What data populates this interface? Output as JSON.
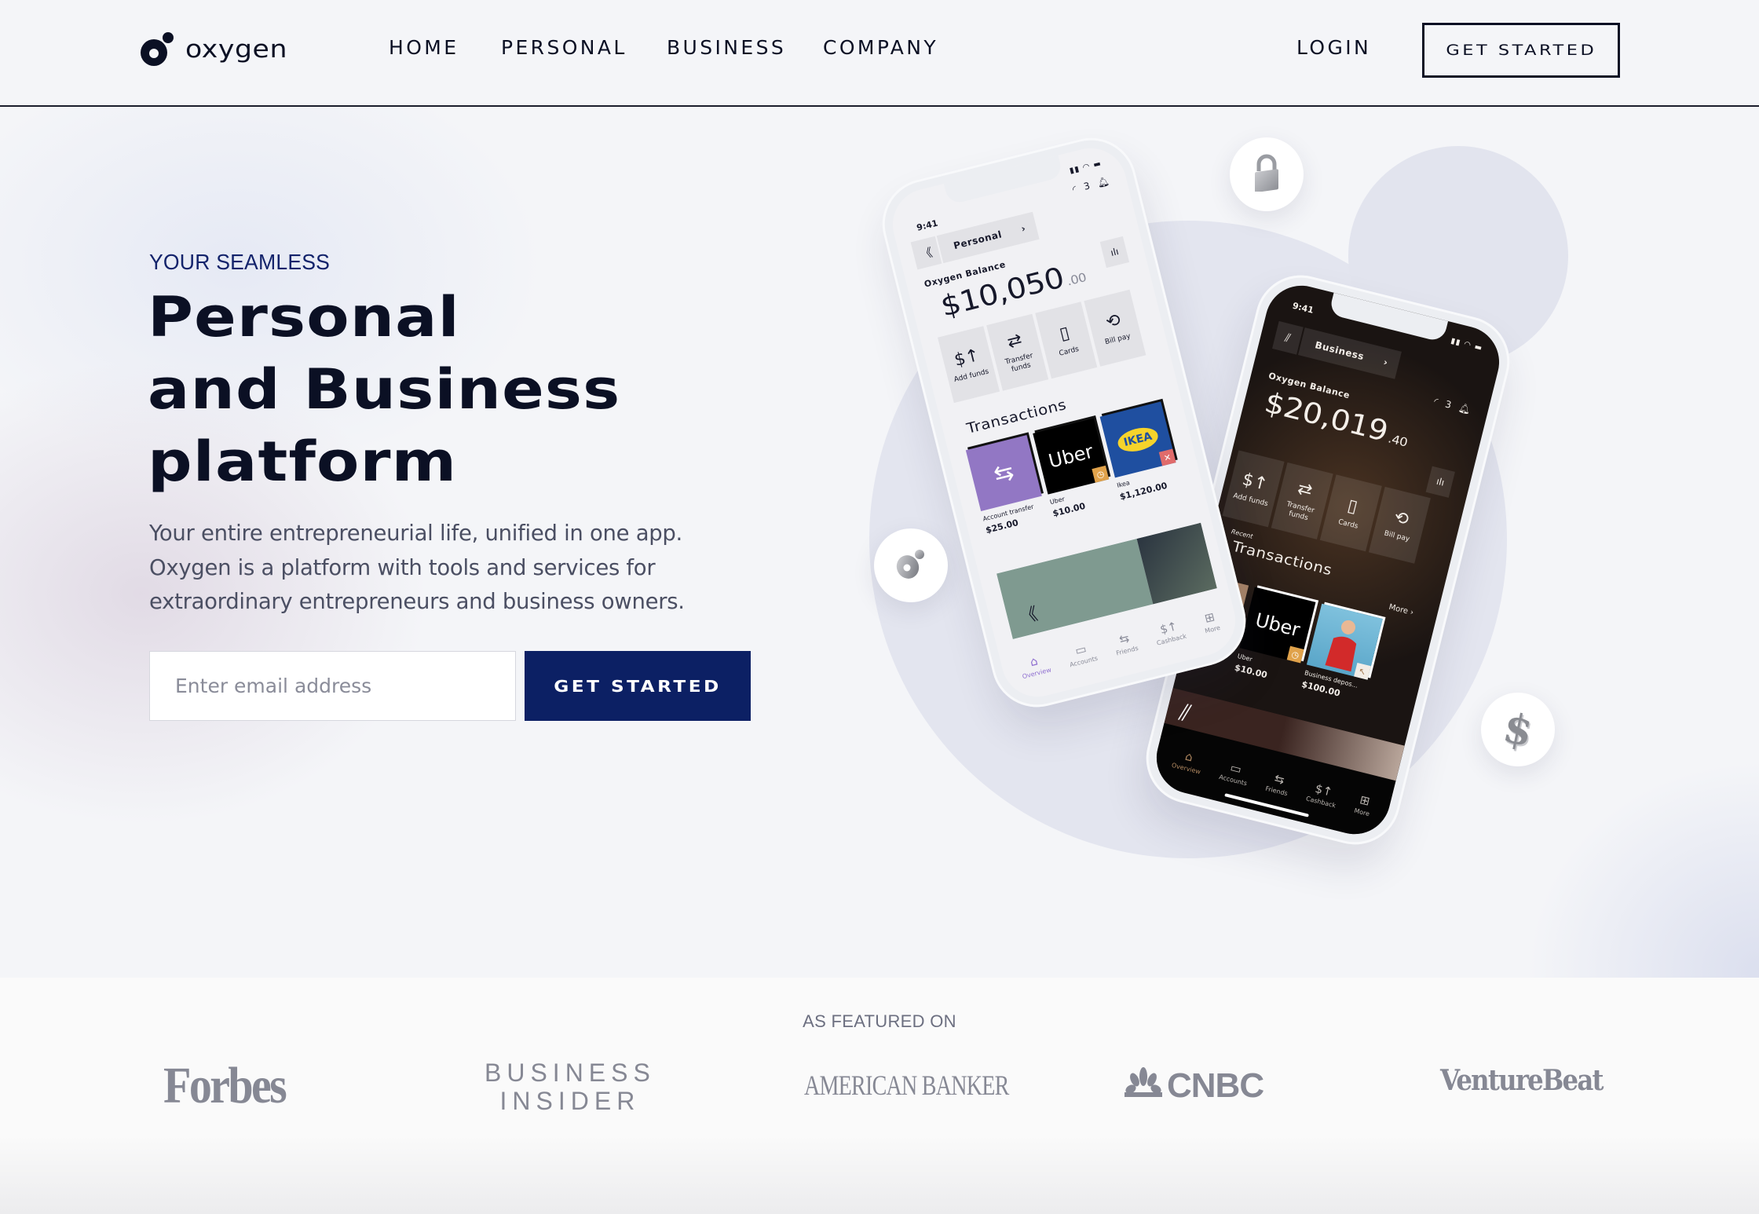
{
  "header": {
    "brand": "oxygen",
    "nav": [
      {
        "label": "HOME"
      },
      {
        "label": "PERSONAL"
      },
      {
        "label": "BUSINESS"
      },
      {
        "label": "COMPANY"
      }
    ],
    "login_label": "LOGIN",
    "cta_label": "GET STARTED"
  },
  "hero": {
    "eyebrow": "YOUR SEAMLESS",
    "headline_lines": [
      "Personal",
      "and Business",
      "platform"
    ],
    "lead": "Your entire entrepreneurial life, unified in one app. Oxygen is a platform with tools and services for extraordinary entrepreneurs and business owners.",
    "email_placeholder": "Enter email address",
    "email_value": "",
    "cta_label": "GET STARTED",
    "colors": {
      "accent": "#0c2064",
      "eyebrow": "#13236b",
      "text": "#0b1024",
      "muted": "#4b4f63"
    }
  },
  "badges": [
    {
      "icon": "lock-icon"
    },
    {
      "icon": "oxygen-logo-icon"
    },
    {
      "icon": "dollar-icon"
    }
  ],
  "phone_personal": {
    "time": "9:41",
    "account": "Personal",
    "notifications": "3",
    "balance_label": "Oxygen Balance",
    "balance_main": "$10,050",
    "balance_cents": ".00",
    "actions": [
      {
        "label": "Add funds",
        "icon": "add-funds-icon"
      },
      {
        "label": "Transfer funds",
        "icon": "transfer-icon"
      },
      {
        "label": "Cards",
        "icon": "cards-icon"
      },
      {
        "label": "Bill pay",
        "icon": "bill-pay-icon"
      }
    ],
    "transactions_title": "Transactions",
    "transactions": [
      {
        "name": "Account transfer",
        "amount": "$25.00",
        "thumb_text": "⇆",
        "thumb_color": "#9277c4"
      },
      {
        "name": "Uber",
        "amount": "$10.00",
        "thumb_text": "Uber",
        "thumb_color": "#000000"
      },
      {
        "name": "Ikea",
        "amount": "$1,120.00",
        "thumb_text": "IKEA",
        "thumb_color": "#1f4fa0"
      }
    ],
    "tabs": [
      {
        "label": "Overview",
        "icon": "home-icon",
        "active": true
      },
      {
        "label": "Accounts",
        "icon": "accounts-icon"
      },
      {
        "label": "Friends",
        "icon": "friends-icon"
      },
      {
        "label": "Cashback",
        "icon": "cashback-icon"
      },
      {
        "label": "More",
        "icon": "grid-icon"
      }
    ]
  },
  "phone_business": {
    "time": "9:41",
    "account": "Business",
    "notifications": "3",
    "balance_label": "Oxygen Balance",
    "balance_main": "$20,019",
    "balance_cents": ".40",
    "actions": [
      {
        "label": "Add funds",
        "icon": "add-funds-icon"
      },
      {
        "label": "Transfer funds",
        "icon": "transfer-icon"
      },
      {
        "label": "Cards",
        "icon": "cards-icon"
      },
      {
        "label": "Bill pay",
        "icon": "bill-pay-icon"
      }
    ],
    "recent_label": "Recent",
    "transactions_title": "Transactions",
    "more_label": "More",
    "transactions": [
      {
        "name": "Uber",
        "amount": "$10.00",
        "thumb_text": "Uber",
        "thumb_color": "#000000"
      },
      {
        "name": "Business depos...",
        "amount": "$100.00",
        "thumb_text": "",
        "thumb_color": "#6fb6d6"
      }
    ],
    "tabs": [
      {
        "label": "Overview",
        "icon": "home-icon",
        "active": true
      },
      {
        "label": "Accounts",
        "icon": "accounts-icon"
      },
      {
        "label": "Friends",
        "icon": "friends-icon"
      },
      {
        "label": "Cashback",
        "icon": "cashback-icon"
      },
      {
        "label": "More",
        "icon": "grid-icon"
      }
    ]
  },
  "featured": {
    "label": "AS FEATURED ON",
    "logos": [
      {
        "name": "Forbes",
        "text": "Forbes"
      },
      {
        "name": "Business Insider",
        "line1": "BUSINESS",
        "line2": "INSIDER"
      },
      {
        "name": "American Banker",
        "text": "AMERICAN BANKER"
      },
      {
        "name": "CNBC",
        "text": "CNBC"
      },
      {
        "name": "VentureBeat",
        "text": "VentureBeat"
      }
    ],
    "logo_color": "#868894"
  }
}
